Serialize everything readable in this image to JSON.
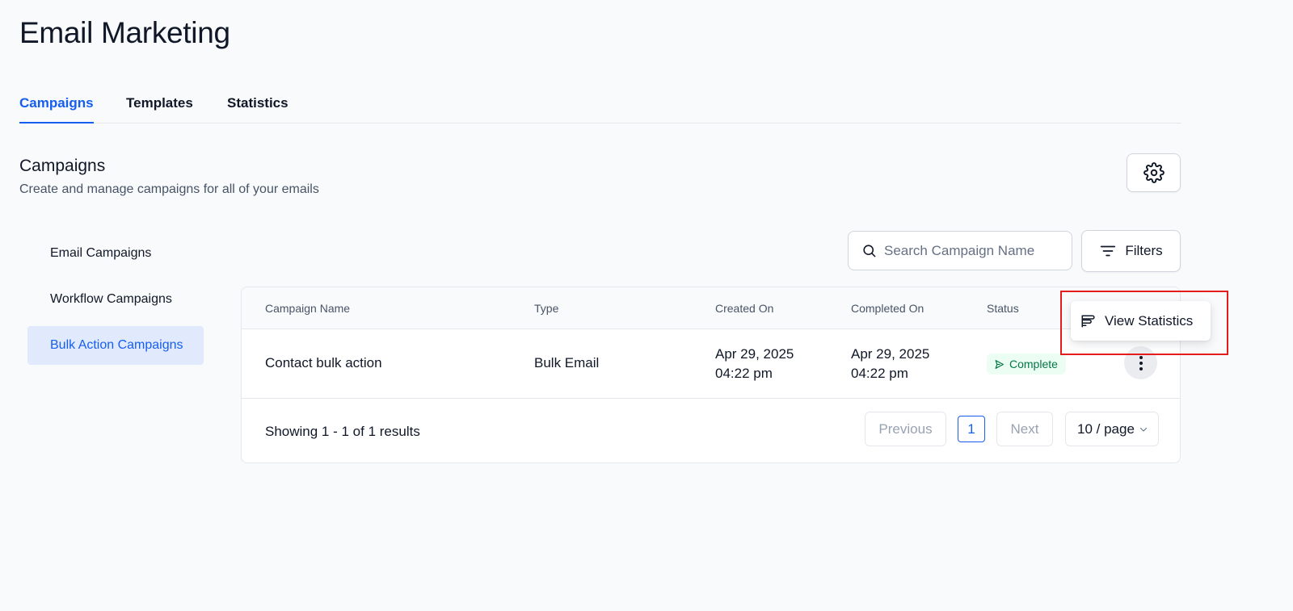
{
  "header": {
    "title": "Email Marketing"
  },
  "tabs": [
    {
      "label": "Campaigns",
      "active": true
    },
    {
      "label": "Templates",
      "active": false
    },
    {
      "label": "Statistics",
      "active": false
    }
  ],
  "section": {
    "title": "Campaigns",
    "subtitle": "Create and manage campaigns for all of your emails"
  },
  "sidebar": {
    "items": [
      {
        "label": "Email Campaigns",
        "active": false
      },
      {
        "label": "Workflow Campaigns",
        "active": false
      },
      {
        "label": "Bulk Action Campaigns",
        "active": true
      }
    ]
  },
  "search": {
    "placeholder": "Search Campaign Name",
    "value": ""
  },
  "filters": {
    "label": "Filters"
  },
  "table": {
    "columns": [
      "Campaign Name",
      "Type",
      "Created On",
      "Completed On",
      "Status"
    ],
    "rows": [
      {
        "name": "Contact bulk action",
        "type": "Bulk Email",
        "created_date": "Apr 29, 2025",
        "created_time": "04:22 pm",
        "completed_date": "Apr 29, 2025",
        "completed_time": "04:22 pm",
        "status": "Complete"
      }
    ]
  },
  "pagination": {
    "summary": "Showing 1 - 1 of 1 results",
    "previous": "Previous",
    "current_page": "1",
    "next": "Next",
    "per_page": "10 / page"
  },
  "menu": {
    "view_statistics": "View Statistics"
  },
  "colors": {
    "accent": "#155eef",
    "status_complete_bg": "#ecfdf3",
    "status_complete_text": "#067647",
    "highlight": "#e41c1c"
  },
  "icons": [
    "gear-icon",
    "search-icon",
    "filter-icon",
    "send-icon",
    "more-vertical-icon",
    "statistics-icon",
    "chevron-down-icon"
  ]
}
